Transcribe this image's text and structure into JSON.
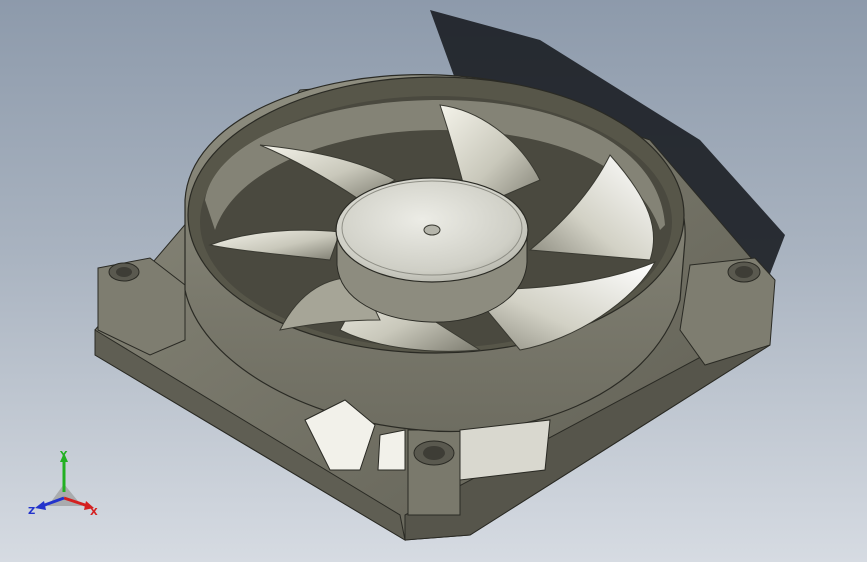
{
  "viewport": {
    "background_top": "#8d9aab",
    "background_bottom": "#d6dbe2"
  },
  "model": {
    "body_color": "#6b6a5e",
    "blade_color": "#e9e8dd",
    "hub_color": "#d7d7cf",
    "blade_count": 7
  },
  "triad": {
    "x_label": "X",
    "y_label": "Y",
    "z_label": "Z",
    "x_color": "#d42020",
    "y_color": "#22b022",
    "z_color": "#2233cc"
  }
}
